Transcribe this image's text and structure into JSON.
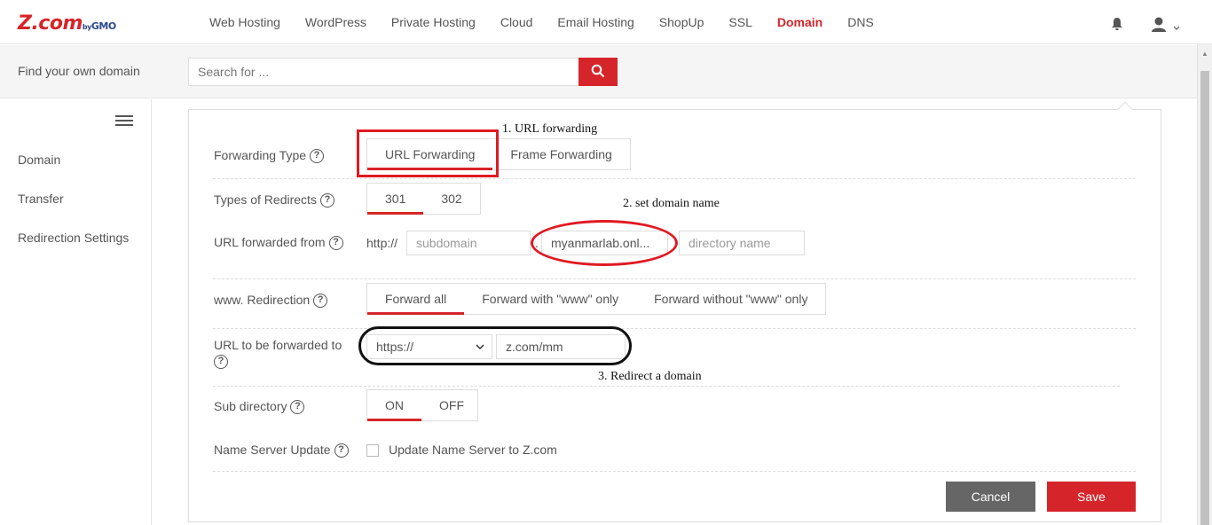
{
  "header": {
    "logo_text": "Z.com",
    "logo_by": "by",
    "logo_gmo": "GMO",
    "nav": [
      "Web Hosting",
      "WordPress",
      "Private Hosting",
      "Cloud",
      "Email Hosting",
      "ShopUp",
      "SSL",
      "Domain",
      "DNS"
    ],
    "active_nav": "Domain"
  },
  "search": {
    "label": "Find your own domain",
    "placeholder": "Search for ..."
  },
  "sidebar": {
    "items": [
      "Domain",
      "Transfer",
      "Redirection Settings"
    ]
  },
  "form": {
    "forwarding_type": {
      "label": "Forwarding Type",
      "options": [
        "URL Forwarding",
        "Frame Forwarding"
      ],
      "selected": "URL Forwarding"
    },
    "redirect_type": {
      "label": "Types of Redirects",
      "options": [
        "301",
        "302"
      ],
      "selected": "301"
    },
    "url_from": {
      "label": "URL forwarded from",
      "prefix": "http://",
      "subdomain_placeholder": "subdomain",
      "dot": ".",
      "domain_value": "myanmarlab.onl...",
      "directory_placeholder": "directory name"
    },
    "www_redirection": {
      "label": "www. Redirection",
      "options": [
        "Forward all",
        "Forward with \"www\" only",
        "Forward without \"www\" only"
      ],
      "selected": "Forward all"
    },
    "url_to": {
      "label": "URL to be forwarded to",
      "protocol": "https://",
      "value": "z.com/mm"
    },
    "sub_directory": {
      "label": "Sub directory",
      "options": [
        "ON",
        "OFF"
      ],
      "selected": "ON"
    },
    "ns_update": {
      "label": "Name Server Update",
      "checkbox_label": "Update Name Server to Z.com",
      "checked": false
    },
    "cancel_label": "Cancel",
    "save_label": "Save"
  },
  "annotations": {
    "a1": "1. URL forwarding",
    "a2": "2. set domain name",
    "a3": "3. Redirect a domain"
  },
  "colors": {
    "brand_red": "#d6252a",
    "cancel_gray": "#666666"
  }
}
